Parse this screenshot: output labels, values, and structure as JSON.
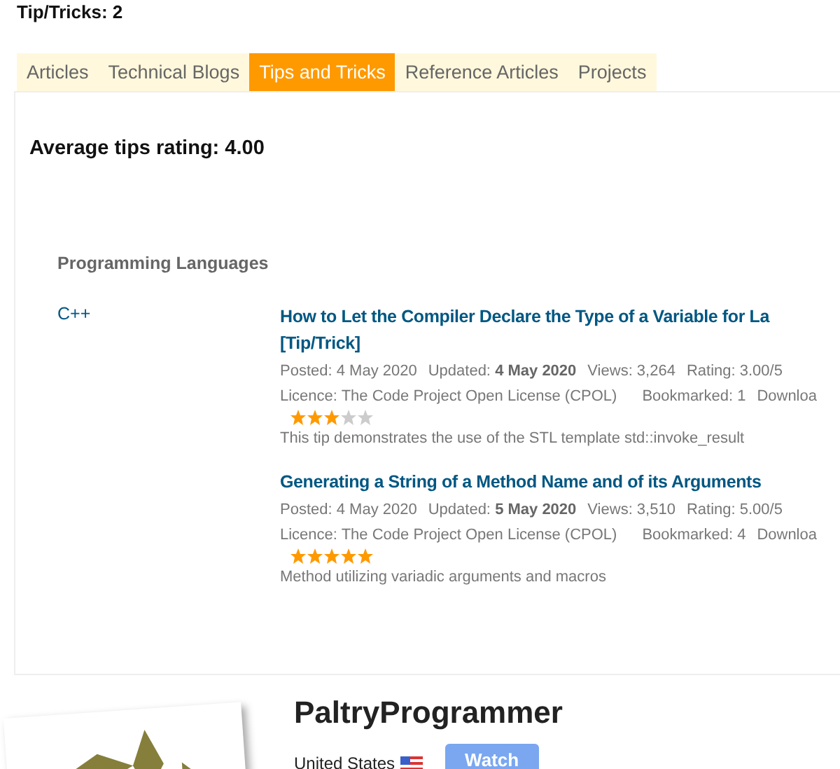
{
  "heading": "Tip/Tricks: 2",
  "tabs": [
    {
      "label": "Articles",
      "selected": false
    },
    {
      "label": "Technical Blogs",
      "selected": false
    },
    {
      "label": "Tips and Tricks",
      "selected": true
    },
    {
      "label": "Reference Articles",
      "selected": false
    },
    {
      "label": "Projects",
      "selected": false
    }
  ],
  "average_rating": "Average tips rating: 4.00",
  "section": "Programming Languages",
  "category": "C++",
  "items": [
    {
      "title": "How to Let the Compiler Declare the Type of a Variable for La",
      "suffix": "[Tip/Trick]",
      "posted": "Posted: 4 May 2020",
      "updated_label": "Updated:",
      "updated": "4 May 2020",
      "views": "Views: 3,264",
      "rating": "Rating: 3.00/5",
      "licence": "Licence: The Code Project Open License (CPOL)",
      "bookmarked": "Bookmarked: 1",
      "downloads": "Downloa",
      "stars": 3,
      "summary": "This tip demonstrates the use of the STL template std::invoke_result"
    },
    {
      "title": "Generating a String of a Method Name and of its Arguments",
      "posted": "Posted: 4 May 2020",
      "updated_label": "Updated:",
      "updated": "5 May 2020",
      "views": "Views: 3,510",
      "rating": "Rating: 5.00/5",
      "licence": "Licence: The Code Project Open License (CPOL)",
      "bookmarked": "Bookmarked: 4",
      "downloads": "Downloa",
      "stars": 5,
      "summary": "Method utilizing variadic arguments and macros"
    }
  ],
  "profile": {
    "name": "PaltryProgrammer",
    "country": "United States",
    "watch_button": "Watch"
  }
}
